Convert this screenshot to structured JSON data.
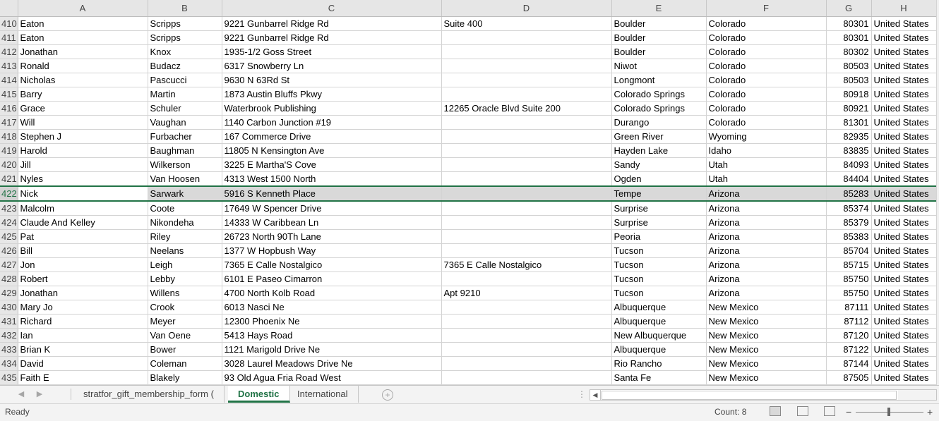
{
  "columns": [
    "A",
    "B",
    "C",
    "D",
    "E",
    "F",
    "G",
    "H"
  ],
  "rows": [
    {
      "n": "410",
      "a": "Eaton",
      "b": "Scripps",
      "c": "9221 Gunbarrel Ridge Rd",
      "d": "Suite 400",
      "e": "Boulder",
      "f": "Colorado",
      "g": "80301",
      "h": "United States"
    },
    {
      "n": "411",
      "a": "Eaton",
      "b": "Scripps",
      "c": "9221 Gunbarrel Ridge Rd",
      "d": "",
      "e": "Boulder",
      "f": "Colorado",
      "g": "80301",
      "h": "United States"
    },
    {
      "n": "412",
      "a": "Jonathan",
      "b": "Knox",
      "c": "1935-1/2 Goss Street",
      "d": "",
      "e": "Boulder",
      "f": "Colorado",
      "g": "80302",
      "h": "United States"
    },
    {
      "n": "413",
      "a": "Ronald",
      "b": "Budacz",
      "c": "6317 Snowberry Ln",
      "d": "",
      "e": "Niwot",
      "f": "Colorado",
      "g": "80503",
      "h": "United States"
    },
    {
      "n": "414",
      "a": "Nicholas",
      "b": "Pascucci",
      "c": "9630 N  63Rd St",
      "d": "",
      "e": "Longmont",
      "f": "Colorado",
      "g": "80503",
      "h": "United States"
    },
    {
      "n": "415",
      "a": "Barry",
      "b": "Martin",
      "c": "1873 Austin Bluffs Pkwy",
      "d": "",
      "e": "Colorado Springs",
      "f": "Colorado",
      "g": "80918",
      "h": "United States"
    },
    {
      "n": "416",
      "a": "Grace",
      "b": "Schuler",
      "c": "Waterbrook Publishing",
      "d": "12265 Oracle Blvd  Suite 200",
      "e": "Colorado Springs",
      "f": "Colorado",
      "g": "80921",
      "h": "United States"
    },
    {
      "n": "417",
      "a": "Will",
      "b": "Vaughan",
      "c": "1140 Carbon Junction  #19",
      "d": "",
      "e": "Durango",
      "f": "Colorado",
      "g": "81301",
      "h": "United States"
    },
    {
      "n": "418",
      "a": "Stephen J",
      "b": "Furbacher",
      "c": "167 Commerce Drive",
      "d": "",
      "e": "Green River",
      "f": "Wyoming",
      "g": "82935",
      "h": "United States"
    },
    {
      "n": "419",
      "a": "Harold",
      "b": "Baughman",
      "c": "11805 N  Kensington Ave",
      "d": "",
      "e": "Hayden Lake",
      "f": "Idaho",
      "g": "83835",
      "h": "United States"
    },
    {
      "n": "420",
      "a": "Jill",
      "b": "Wilkerson",
      "c": "3225 E  Martha'S Cove",
      "d": "",
      "e": "Sandy",
      "f": "Utah",
      "g": "84093",
      "h": "United States"
    },
    {
      "n": "421",
      "a": "Nyles",
      "b": "Van Hoosen",
      "c": "4313 West 1500 North",
      "d": "",
      "e": "Ogden",
      "f": "Utah",
      "g": "84404",
      "h": "United States"
    },
    {
      "n": "422",
      "a": "Nick",
      "b": "Sarwark",
      "c": "5916 S  Kenneth Place",
      "d": "",
      "e": "Tempe",
      "f": "Arizona",
      "g": "85283",
      "h": "United States"
    },
    {
      "n": "423",
      "a": "Malcolm",
      "b": "Coote",
      "c": "17649 W  Spencer Drive",
      "d": "",
      "e": "Surprise",
      "f": "Arizona",
      "g": "85374",
      "h": "United States"
    },
    {
      "n": "424",
      "a": "Claude And Kelley",
      "b": "Nikondeha",
      "c": "14333 W  Caribbean Ln",
      "d": "",
      "e": "Surprise",
      "f": "Arizona",
      "g": "85379",
      "h": "United States"
    },
    {
      "n": "425",
      "a": "Pat",
      "b": "Riley",
      "c": "26723 North 90Th Lane",
      "d": "",
      "e": "Peoria",
      "f": "Arizona",
      "g": "85383",
      "h": "United States"
    },
    {
      "n": "426",
      "a": "Bill",
      "b": "Neelans",
      "c": "1377 W  Hopbush Way",
      "d": "",
      "e": "Tucson",
      "f": "Arizona",
      "g": "85704",
      "h": "United States"
    },
    {
      "n": "427",
      "a": "Jon",
      "b": "Leigh",
      "c": "7365 E  Calle Nostalgico",
      "d": "7365 E  Calle Nostalgico",
      "e": "Tucson",
      "f": "Arizona",
      "g": "85715",
      "h": "United States"
    },
    {
      "n": "428",
      "a": "Robert",
      "b": "Lebby",
      "c": "6101 E  Paseo Cimarron",
      "d": "",
      "e": "Tucson",
      "f": "Arizona",
      "g": "85750",
      "h": "United States"
    },
    {
      "n": "429",
      "a": "Jonathan",
      "b": "Willens",
      "c": "4700 North Kolb Road",
      "d": "Apt 9210",
      "e": "Tucson",
      "f": "Arizona",
      "g": "85750",
      "h": "United States"
    },
    {
      "n": "430",
      "a": "Mary Jo",
      "b": "Crook",
      "c": "6013 Nasci Ne",
      "d": "",
      "e": "Albuquerque",
      "f": "New Mexico",
      "g": "87111",
      "h": "United States"
    },
    {
      "n": "431",
      "a": "Richard",
      "b": "Meyer",
      "c": "12300 Phoenix Ne",
      "d": "",
      "e": "Albuquerque",
      "f": "New Mexico",
      "g": "87112",
      "h": "United States"
    },
    {
      "n": "432",
      "a": "Ian",
      "b": "Van Oene",
      "c": "5413 Hays Road",
      "d": "",
      "e": "New Albuquerque",
      "f": "New Mexico",
      "g": "87120",
      "h": "United States"
    },
    {
      "n": "433",
      "a": "Brian K",
      "b": "Bower",
      "c": "1121 Marigold Drive Ne",
      "d": "",
      "e": "Albuquerque",
      "f": "New Mexico",
      "g": "87122",
      "h": "United States"
    },
    {
      "n": "434",
      "a": "David",
      "b": "Coleman",
      "c": "3028 Laurel Meadows Drive Ne",
      "d": "",
      "e": "Rio Rancho",
      "f": "New Mexico",
      "g": "87144",
      "h": "United States"
    },
    {
      "n": "435",
      "a": "Faith E",
      "b": "Blakely",
      "c": "93 Old Agua Fria Road West",
      "d": "",
      "e": "Santa Fe",
      "f": "New Mexico",
      "g": "87505",
      "h": "United States"
    }
  ],
  "selected_row": "422",
  "sheets": {
    "tab1": "stratfor_gift_membership_form (",
    "tab2": "Domestic",
    "tab3": "International"
  },
  "status": {
    "ready": "Ready",
    "count": "Count: 8"
  },
  "colors": {
    "accent": "#217346",
    "header_bg": "#e6e6e6",
    "selected_bg": "#d9d9d9"
  }
}
